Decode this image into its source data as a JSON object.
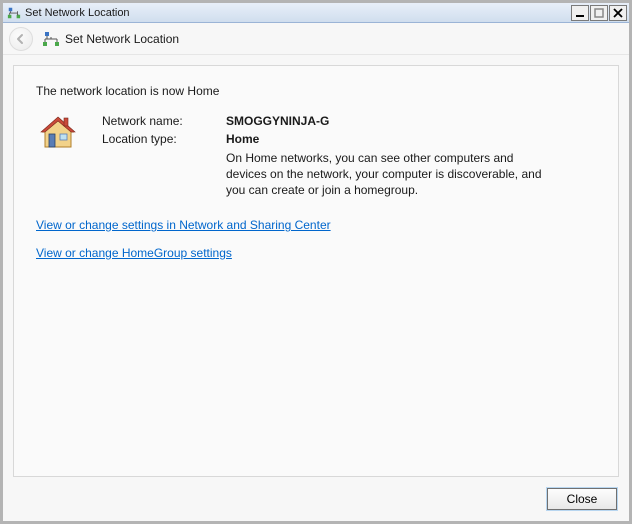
{
  "titlebar": {
    "title": "Set Network Location"
  },
  "header": {
    "title": "Set Network Location"
  },
  "content": {
    "status": "The network location is now Home",
    "network_name_label": "Network name:",
    "network_name_value": "SMOGGYNINJA-G",
    "location_type_label": "Location type:",
    "location_type_value": "Home",
    "description": "On Home networks, you can see other computers and devices on the network, your computer is discoverable, and you can create or join a homegroup.",
    "link1": "View or change settings in Network and Sharing Center",
    "link2": "View or change HomeGroup settings"
  },
  "footer": {
    "close": "Close"
  }
}
